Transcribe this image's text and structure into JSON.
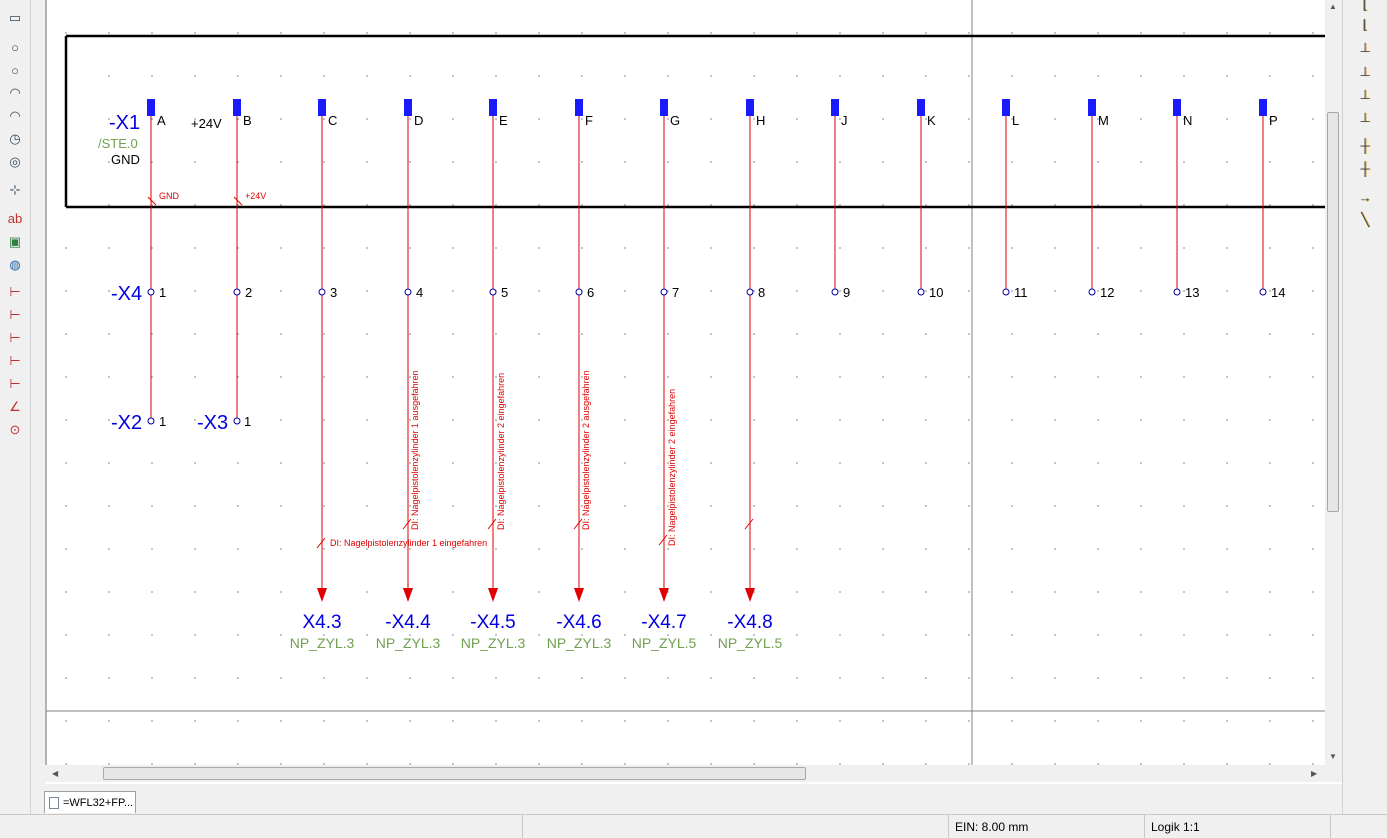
{
  "document_tab": {
    "label": "=WFL32+FP..."
  },
  "statusbar": {
    "ein": "EIN: 8.00 mm",
    "logik": "Logik 1:1"
  },
  "schematic": {
    "connector_top": {
      "ref": "-X1",
      "location": "/STE.0",
      "gnd_label": "GND",
      "plus24v_label": "+24V",
      "pins": [
        "A",
        "B",
        "C",
        "D",
        "E",
        "F",
        "G",
        "H",
        "J",
        "K",
        "L",
        "M",
        "N",
        "P"
      ],
      "potential_gnd": "GND",
      "potential_24v": "+24V"
    },
    "terminal_strip": {
      "ref": "-X4",
      "terminals": [
        "1",
        "2",
        "3",
        "4",
        "5",
        "6",
        "7",
        "8",
        "9",
        "10",
        "11",
        "12",
        "13",
        "14"
      ]
    },
    "connector_x2": {
      "ref": "-X2",
      "terminal": "1"
    },
    "connector_x3": {
      "ref": "-X3",
      "terminal": "1"
    },
    "signal_labels": [
      "DI: Nagelpistolenzylinder 1 eingefahren",
      "DI: Nagelpistolenzylinder 1 ausgefahren",
      "DI: Nagelpistolenzylinder 2 eingefahren",
      "DI: Nagelpistolenzylinder 2 ausgefahren",
      "DI: Nagelpistolenzylinder 2 eingefahren"
    ],
    "targets": [
      {
        "ref": "X4.3",
        "loc": "NP_ZYL.3"
      },
      {
        "ref": "-X4.4",
        "loc": "NP_ZYL.3"
      },
      {
        "ref": "-X4.5",
        "loc": "NP_ZYL.3"
      },
      {
        "ref": "-X4.6",
        "loc": "NP_ZYL.3"
      },
      {
        "ref": "-X4.7",
        "loc": "NP_ZYL.5"
      },
      {
        "ref": "-X4.8",
        "loc": "NP_ZYL.5"
      }
    ]
  },
  "colors": {
    "wire": "#e00000",
    "ref_text": "#0000e0",
    "location_text": "#70a050",
    "pin_block": "#1a1aff",
    "frame": "#000000",
    "grid_dot": "#9a9a9a"
  },
  "toolbar_icons_left": [
    "select-icon",
    "rectangle-icon",
    "circle-icon",
    "circle-icon",
    "arc-icon",
    "arc-icon",
    "clock-icon",
    "ellipse-icon",
    "node-icon",
    "text-icon",
    "image-icon",
    "globe-icon",
    "dimension-icon",
    "dimension-icon",
    "dimension-icon",
    "dimension-icon",
    "dimension-icon",
    "angle-icon",
    "radius-icon"
  ],
  "toolbar_icons_right": [
    "corner-icon",
    "corner-icon",
    "tee-icon",
    "tee-icon",
    "tee-icon",
    "tee-icon",
    "cross-icon",
    "cross-icon",
    "arrow-icon",
    "diagonal-icon"
  ]
}
